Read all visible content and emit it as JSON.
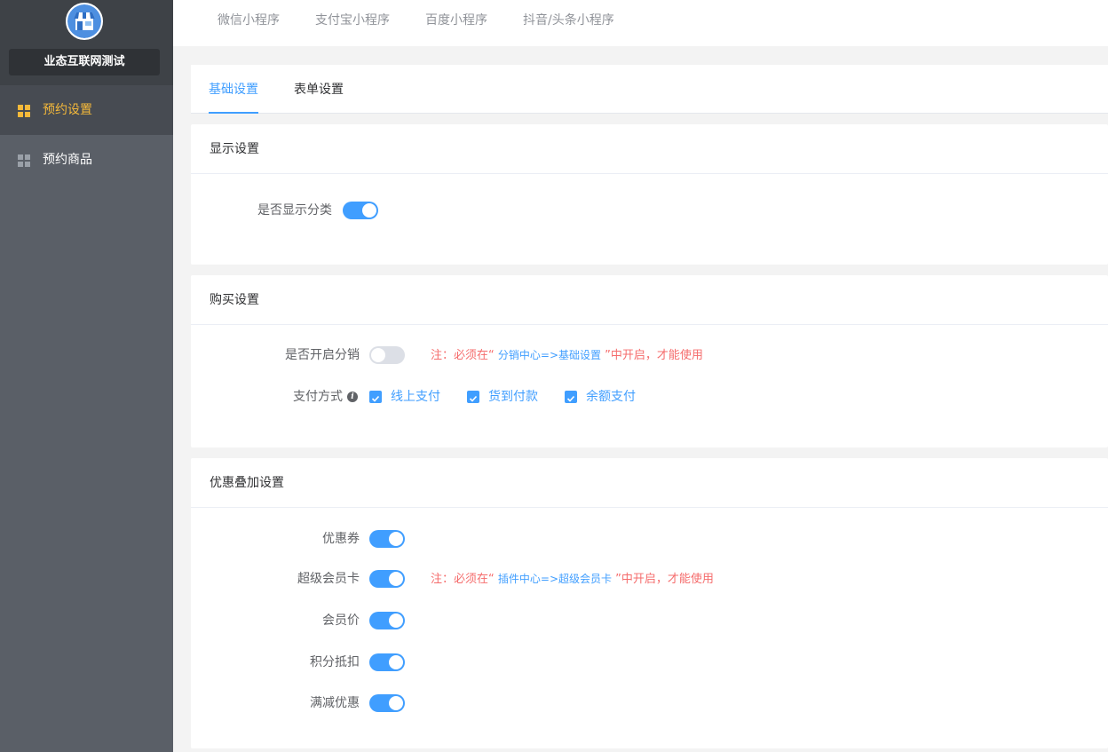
{
  "sidebar": {
    "shop_name": "业态互联网测试",
    "items": [
      {
        "label": "预约设置",
        "icon": "grid-icon",
        "active": true
      },
      {
        "label": "预约商品",
        "icon": "grid-icon",
        "active": false
      }
    ]
  },
  "top_tabs": [
    "微信小程序",
    "支付宝小程序",
    "百度小程序",
    "抖音/头条小程序"
  ],
  "sub_tabs": {
    "basic": "基础设置",
    "form": "表单设置",
    "active": "基础设置"
  },
  "display_settings": {
    "title": "显示设置",
    "show_category": {
      "label": "是否显示分类",
      "enabled": true
    }
  },
  "purchase_settings": {
    "title": "购买设置",
    "distribution": {
      "label": "是否开启分销",
      "enabled": false,
      "note_prefix": "注：必须在“",
      "note_link": "分销中心=>基础设置",
      "note_suffix": "”中开启，才能使用"
    },
    "payment": {
      "label": "支付方式",
      "options": [
        {
          "label": "线上支付",
          "checked": true
        },
        {
          "label": "货到付款",
          "checked": true
        },
        {
          "label": "余额支付",
          "checked": true
        }
      ]
    }
  },
  "discount_settings": {
    "title": "优惠叠加设置",
    "coupon": {
      "label": "优惠券",
      "enabled": true
    },
    "super_card": {
      "label": "超级会员卡",
      "enabled": true,
      "note_prefix": "注：必须在“",
      "note_link": "插件中心=>超级会员卡",
      "note_suffix": "”中开启，才能使用"
    },
    "member_price": {
      "label": "会员价",
      "enabled": true
    },
    "points": {
      "label": "积分抵扣",
      "enabled": true
    },
    "full_reduction": {
      "label": "满减优惠",
      "enabled": true
    }
  },
  "colors": {
    "accent": "#409eff",
    "nav_active": "#f5b93a",
    "warning": "#f56c6c"
  }
}
